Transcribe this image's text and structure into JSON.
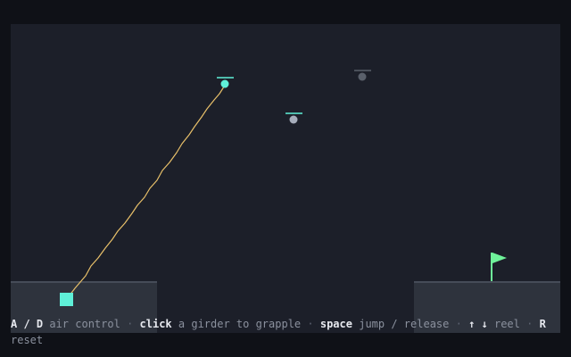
{
  "controls": [
    {
      "key": "A / D",
      "action": "air control"
    },
    {
      "key": "click",
      "action": "a girder to grapple"
    },
    {
      "key": "space",
      "action": "jump / release"
    },
    {
      "key": "↑ ↓",
      "action": "reel"
    },
    {
      "key": "R",
      "action": "reset"
    }
  ],
  "separator": " · ",
  "colors": {
    "background": "#0f1117",
    "canvas": "#1c1f29",
    "platform": "#2e333d",
    "platform_edge": "#464c58",
    "player": "#5ff0d8",
    "rope": "#e8c06a",
    "anchor_active": "#5ff0d8",
    "anchor_idle": "#a6adbb",
    "anchor_far": "#5a606b",
    "flag": "#6ff29a"
  }
}
